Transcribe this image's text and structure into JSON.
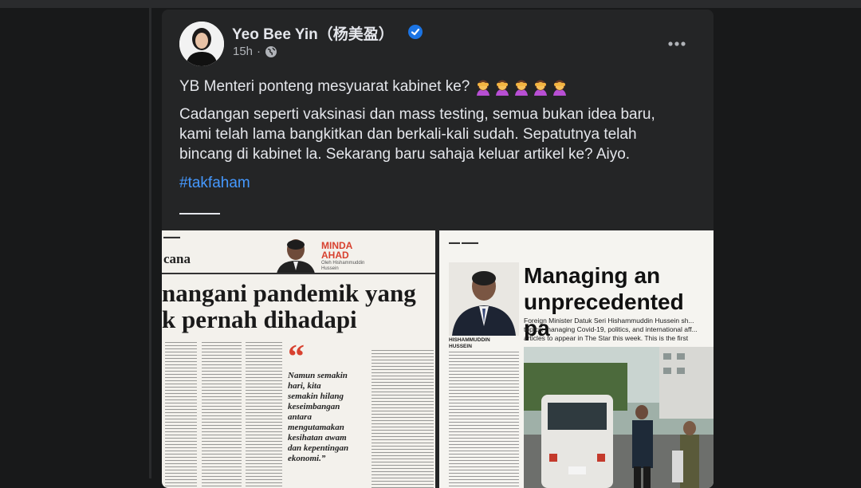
{
  "post": {
    "author": "Yeo Bee Yin（杨美盈）",
    "timestamp": "15h",
    "line1": "YB Menteri ponteng mesyuarat kabinet ke?",
    "emoji_count": 5,
    "body": "Cadangan seperti vaksinasi dan mass testing, semua bukan idea baru,\nkami telah lama bangkitkan dan berkali-kali sudah. Sepatutnya telah\nbincang di kabinet la. Sekarang baru sahaja keluar artikel ke? Aiyo.",
    "hashtag": "#takfaham"
  },
  "icons": {
    "verified": "verified-badge-icon",
    "audience": "globe-icon",
    "more": "more-options-icon",
    "emoji": "facepalm-emoji-icon"
  },
  "colors": {
    "background": "#18191a",
    "card": "#242526",
    "text": "#e4e6eb",
    "secondary_text": "#b0b3b8",
    "link": "#4599ff",
    "verified": "#1b74e4",
    "accent_red": "#d8412f"
  },
  "clipping_left": {
    "section": "cana",
    "column_label": "MINDA\nAHAD",
    "byline": "Oleh Hishammuddin Hussein",
    "headline": "nangani pandemik yang\nk pernah dihadapi",
    "quote": "Namun semakin\nhari, kita\nsemakin hilang\nkeseimbangan\nantara\nmengutamakan\nkesihatan awam\ndan kepentingan\nekonomi.”"
  },
  "clipping_right": {
    "headline": "Managing an\nunprecedented pa",
    "deck": "Foreign Minister Datuk Seri Hishammuddin Hussein sh... topics: managing Covid-19, politics, and international aff... articles to appear in The Star this week. This is the first",
    "name_tag": "HISHAMMUDDIN\nHUSSEIN"
  }
}
